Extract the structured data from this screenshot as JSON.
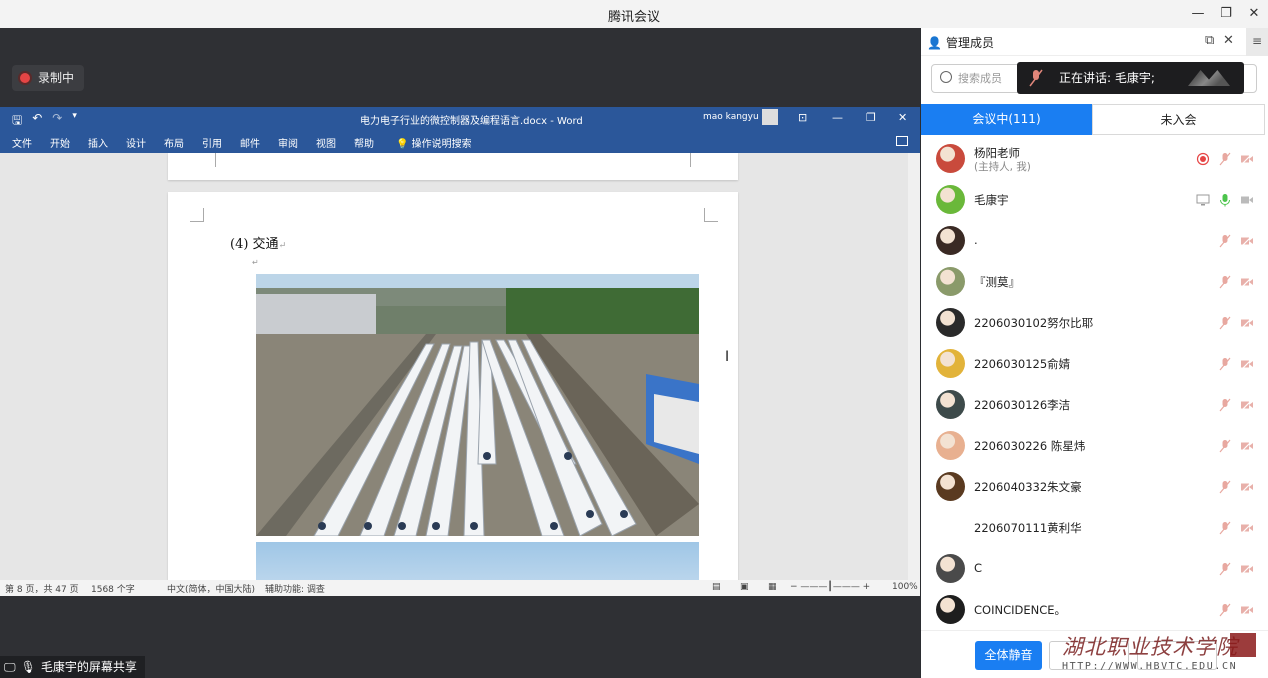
{
  "window": {
    "title": "腾讯会议"
  },
  "recording": {
    "label": "录制中"
  },
  "word": {
    "doc_title": "电力电子行业的微控制器及编程语言.docx - Word",
    "user": "mao kangyu",
    "menus": [
      "文件",
      "开始",
      "插入",
      "设计",
      "布局",
      "引用",
      "邮件",
      "审阅",
      "视图",
      "帮助"
    ],
    "tell_me": "操作说明搜索",
    "heading": "(4) 交通",
    "status": {
      "page": "第 8 页，共 47 页",
      "words": "1568 个字",
      "language": "中文(简体，中国大陆)",
      "accessibility": "辅助功能: 调查",
      "zoom": "100%"
    }
  },
  "share_label": "毛康宇的屏幕共享",
  "panel": {
    "title": "管理成员",
    "search_placeholder": "搜索成员",
    "speaking": "正在讲话: 毛康宇;",
    "tabs": {
      "in_meeting": "会议中(111)",
      "not_joined": "未入会"
    },
    "members": [
      {
        "name": "杨阳老师",
        "sub": "(主持人, 我)",
        "recording": true,
        "mic": "muted",
        "avatar": "#c94a3c"
      },
      {
        "name": "毛康宇",
        "sub": "",
        "sharing": true,
        "mic": "active",
        "avatar": "#6ab83a"
      },
      {
        "name": ".",
        "sub": "",
        "mic": "muted",
        "avatar": "#3a2a24"
      },
      {
        "name": "『测莫』",
        "sub": "",
        "mic": "muted",
        "avatar": "#8a9a6a"
      },
      {
        "name": "2206030102努尔比耶",
        "sub": "",
        "mic": "muted",
        "avatar": "#2a2a2a"
      },
      {
        "name": "2206030125俞婧",
        "sub": "",
        "mic": "muted",
        "avatar": "#e2b33a"
      },
      {
        "name": "2206030126李洁",
        "sub": "",
        "mic": "muted",
        "avatar": "#3d4a4a"
      },
      {
        "name": "2206030226 陈星炜",
        "sub": "",
        "mic": "muted",
        "avatar": "#e8b090"
      },
      {
        "name": "2206040332朱文豪",
        "sub": "",
        "mic": "muted",
        "avatar": "#5a3a20"
      },
      {
        "name": "2206070111黄利华",
        "sub": "",
        "mic": "muted",
        "avatar": ""
      },
      {
        "name": "C",
        "sub": "",
        "mic": "muted",
        "avatar": "#4a4a4a"
      },
      {
        "name": "COINCIDENCE。",
        "sub": "",
        "mic": "muted",
        "avatar": "#1e1e1e"
      }
    ],
    "mute_all": "全体静音",
    "watermark_text": "湖北职业技术学院",
    "watermark_url": "HTTP://WWW.HBVTC.EDU.CN"
  },
  "colors": {
    "accent": "#1a7ef2",
    "word_blue": "#2b579a",
    "rec_red": "#e64545"
  }
}
